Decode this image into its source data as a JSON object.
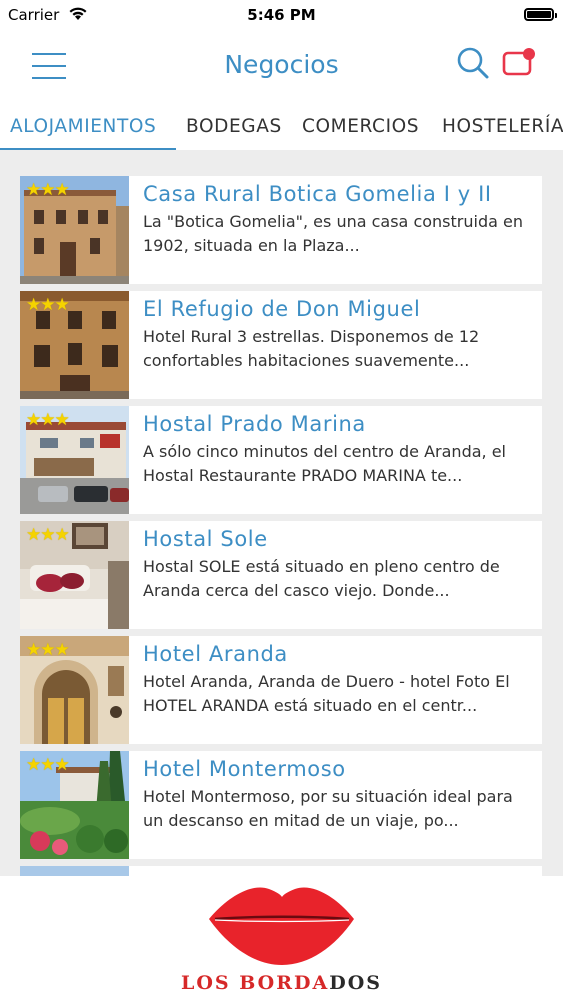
{
  "status_bar": {
    "carrier": "Carrier",
    "time": "5:46 PM"
  },
  "nav": {
    "title": "Negocios",
    "menu_icon": "hamburger-icon",
    "search_icon": "search-icon",
    "cart_icon": "cart-notification-icon"
  },
  "tabs": [
    {
      "label": "ALOJAMIENTOS",
      "active": true
    },
    {
      "label": "BODEGAS"
    },
    {
      "label": "COMERCIOS"
    },
    {
      "label": "HOSTELERÍA"
    }
  ],
  "listings": [
    {
      "title": "Casa Rural Botica Gomelia I y II",
      "stars": "★★★",
      "rating": 3,
      "desc": "La \"Botica Gomelia\", es una casa construida en 1902, situada en la Plaza..."
    },
    {
      "title": "El Refugio de Don Miguel",
      "stars": "★★★",
      "rating": 3,
      "desc": "Hotel Rural 3 estrellas. Disponemos de 12 confortables habitaciones suavemente..."
    },
    {
      "title": "Hostal Prado Marina",
      "stars": "★★★",
      "rating": 3,
      "desc": "A sólo cinco minutos del centro de Aranda, el Hostal Restaurante PRADO MARINA te..."
    },
    {
      "title": "Hostal Sole",
      "stars": "★★★",
      "rating": 3,
      "desc": "Hostal SOLE está situado en pleno centro de Aranda cerca del casco viejo. Donde..."
    },
    {
      "title": "Hotel Aranda",
      "stars": "★★★",
      "rating": 3,
      "desc": "Hotel Aranda, Aranda de Duero - hotel Foto El HOTEL ARANDA está situado en el centr..."
    },
    {
      "title": "Hotel Montermoso",
      "stars": "★★★",
      "rating": 3,
      "desc": "Hotel Montermoso, por su situación ideal para un descanso en mitad de un viaje, po..."
    }
  ],
  "banner": {
    "brand_red_1": "LOS BORDA",
    "brand_dark": "DOS",
    "lip_color": "#e8232b"
  },
  "colors": {
    "accent": "#3d8ec4",
    "star": "#f5d300",
    "list_bg": "#ededed"
  }
}
